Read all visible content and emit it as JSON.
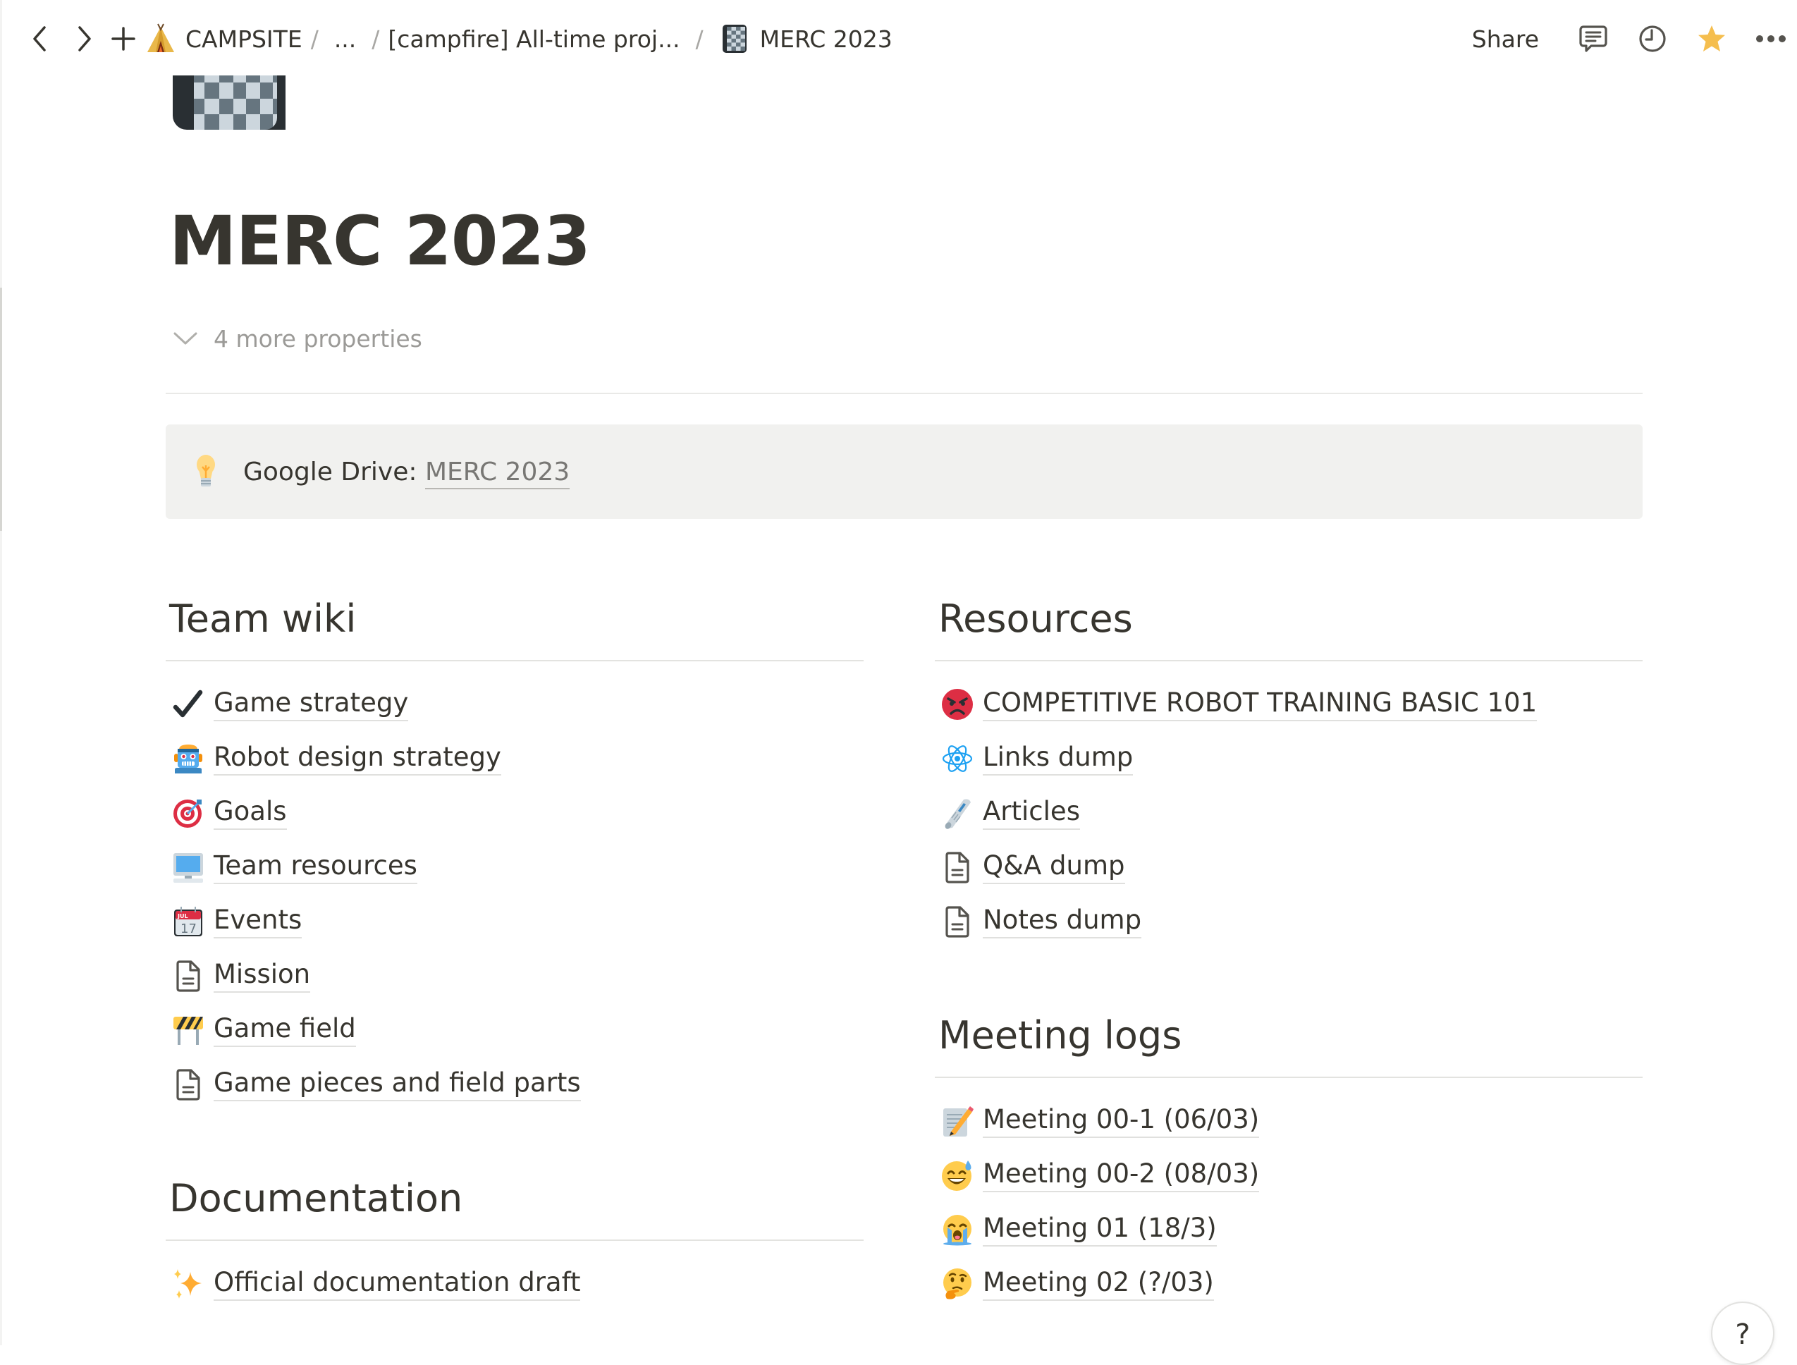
{
  "topbar": {
    "breadcrumbs": [
      {
        "label": "CAMPSITE",
        "icon": "tent-icon"
      },
      {
        "label": "..."
      },
      {
        "label": "[campfire] All-time proj..."
      },
      {
        "label": "MERC 2023",
        "icon": "checkered-page-icon"
      }
    ],
    "separator": "/",
    "share_label": "Share",
    "favorite_color": "#F5BE4E"
  },
  "page": {
    "title": "MERC 2023",
    "icon": "checkered-notebook-icon",
    "properties_toggle": "4 more properties"
  },
  "callout": {
    "icon": "lightbulb-icon",
    "prefix": "Google Drive: ",
    "link_text": "MERC 2023",
    "background": "#F1F1EF"
  },
  "sections": {
    "team_wiki": {
      "heading": "Team wiki",
      "items": [
        {
          "label": "Game strategy",
          "icon": "checkmark-icon"
        },
        {
          "label": "Robot design strategy",
          "icon": "robot-icon"
        },
        {
          "label": "Goals",
          "icon": "target-icon"
        },
        {
          "label": "Team resources",
          "icon": "computer-icon"
        },
        {
          "label": "Events",
          "icon": "calendar-icon"
        },
        {
          "label": "Mission",
          "icon": "page-icon"
        },
        {
          "label": "Game field",
          "icon": "construction-barrier-icon"
        },
        {
          "label": "Game pieces and field parts",
          "icon": "page-icon"
        }
      ]
    },
    "documentation": {
      "heading": "Documentation",
      "items": [
        {
          "label": "Official documentation draft",
          "icon": "sparkles-icon"
        }
      ]
    },
    "resources": {
      "heading": "Resources",
      "items": [
        {
          "label": "COMPETITIVE ROBOT TRAINING BASIC 101",
          "icon": "angry-face-icon"
        },
        {
          "label": "Links dump",
          "icon": "atom-icon"
        },
        {
          "label": "Articles",
          "icon": "newspaper-icon"
        },
        {
          "label": "Q&A dump",
          "icon": "page-icon"
        },
        {
          "label": "Notes dump",
          "icon": "page-icon"
        }
      ]
    },
    "meeting_logs": {
      "heading": "Meeting logs",
      "items": [
        {
          "label": "Meeting 00-1 (06/03)",
          "icon": "memo-icon"
        },
        {
          "label": "Meeting 00-2 (08/03)",
          "icon": "grinning-sweat-icon"
        },
        {
          "label": "Meeting 01 (18/3)",
          "icon": "crying-face-icon"
        },
        {
          "label": "Meeting 02 (?/03)",
          "icon": "thinking-face-icon"
        }
      ]
    }
  },
  "help_button": "?"
}
